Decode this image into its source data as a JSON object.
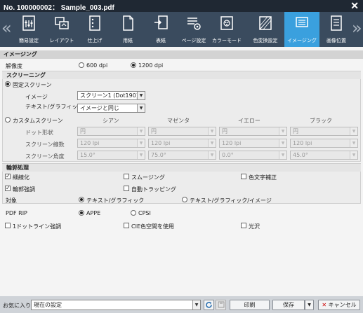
{
  "window": {
    "title": "No. 100000002： Sample_003.pdf"
  },
  "tabs": [
    {
      "label": "簡易設定",
      "icon": "quick-settings-icon"
    },
    {
      "label": "レイアウト",
      "icon": "layout-icon"
    },
    {
      "label": "仕上げ",
      "icon": "finishing-icon"
    },
    {
      "label": "用紙",
      "icon": "paper-icon"
    },
    {
      "label": "表紙",
      "icon": "cover-icon"
    },
    {
      "label": "ページ設定",
      "icon": "page-settings-icon"
    },
    {
      "label": "カラーモード",
      "icon": "color-mode-icon"
    },
    {
      "label": "色変換設定",
      "icon": "color-conversion-icon"
    },
    {
      "label": "イメージング",
      "icon": "imaging-icon"
    },
    {
      "label": "画像位置",
      "icon": "image-position-icon"
    }
  ],
  "active_tab": "イメージング",
  "imaging": {
    "header": "イメージング",
    "resolution_label": "解像度",
    "res_600": "600 dpi",
    "res_1200": "1200 dpi",
    "selected_resolution": "1200 dpi"
  },
  "screening": {
    "header": "スクリーニング",
    "fixed_label": "固定スクリーン",
    "image_label": "イメージ",
    "image_value": "スクリーン1 (Dot190)",
    "text_graphic_label": "テキスト/グラフィック",
    "text_graphic_value": "イメージと同じ",
    "custom_label": "カスタムスクリーン",
    "columns": [
      "シアン",
      "マゼンタ",
      "イエロー",
      "ブラック"
    ],
    "rows": [
      {
        "label": "ドット形状",
        "values": [
          "円",
          "円",
          "円",
          "円"
        ]
      },
      {
        "label": "スクリーン線数",
        "values": [
          "120 lpi",
          "120 lpi",
          "120 lpi",
          "120 lpi"
        ]
      },
      {
        "label": "スクリーン角度",
        "values": [
          "15.0°",
          "75.0°",
          "0.0°",
          "45.0°"
        ]
      }
    ]
  },
  "edge": {
    "header": "輪郭処理",
    "thinning": "細線化",
    "smoothing": "スムージング",
    "color_text_correction": "色文字補正",
    "edge_enhance": "輪郭強調",
    "auto_trapping": "自動トラッピング",
    "target_label": "対象",
    "target_text_graphic": "テキスト/グラフィック",
    "target_text_graphic_image": "テキスト/グラフィック/イメージ"
  },
  "rip": {
    "label": "PDF RIP",
    "appe": "APPE",
    "cpsi": "CPSI",
    "one_dot_line": "1ドットライン強調",
    "cie_color": "CIE色空間を使用",
    "gloss": "光沢"
  },
  "footer": {
    "favorites_label": "お気に入り",
    "favorites_value": "現在の設定",
    "print": "印刷",
    "save": "保存",
    "cancel": "キャンセル"
  }
}
